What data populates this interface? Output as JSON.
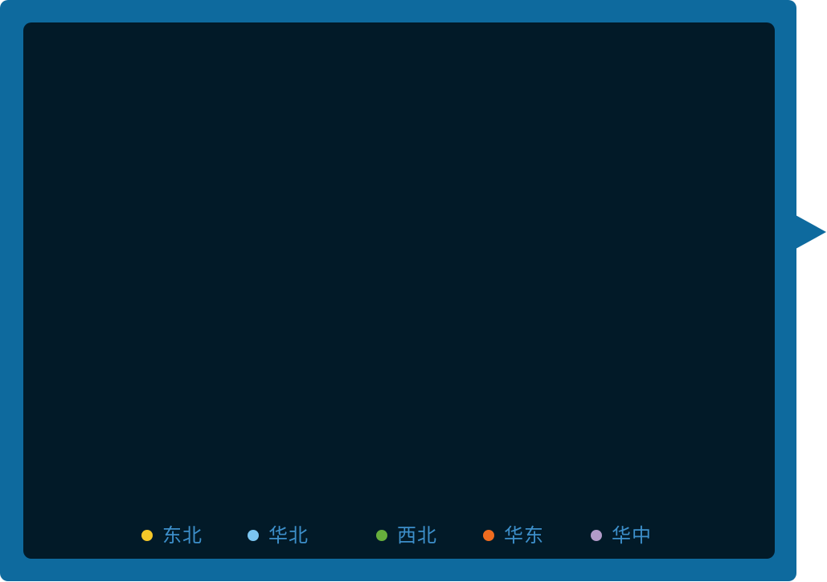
{
  "theme": {
    "frame_color": "#0E6A9E",
    "panel_color": "#021A28",
    "legend_text_color": "#3D8FCA"
  },
  "legend": {
    "items": [
      {
        "label": "东北",
        "color": "#F5C729"
      },
      {
        "label": "华北",
        "color": "#7CC6F2"
      },
      {
        "label": "西北",
        "color": "#67AE3C"
      },
      {
        "label": "华东",
        "color": "#F06C1F"
      },
      {
        "label": "华中",
        "color": "#B29BC9"
      }
    ]
  }
}
